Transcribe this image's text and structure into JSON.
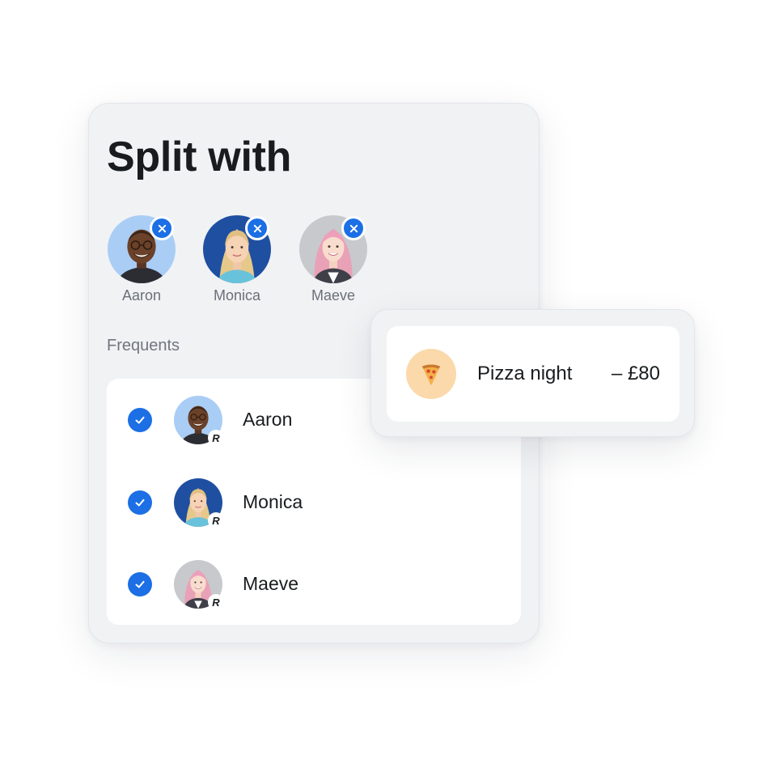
{
  "split_panel": {
    "title": "Split with",
    "selected": [
      {
        "name": "Aaron",
        "remove_icon": "close-icon"
      },
      {
        "name": "Monica",
        "remove_icon": "close-icon"
      },
      {
        "name": "Maeve",
        "remove_icon": "close-icon"
      }
    ],
    "frequents_label": "Frequents",
    "frequents": [
      {
        "name": "Aaron",
        "checked": true,
        "badge": "R"
      },
      {
        "name": "Monica",
        "checked": true,
        "badge": "R"
      },
      {
        "name": "Maeve",
        "checked": true,
        "badge": "R"
      }
    ]
  },
  "transaction": {
    "icon": "pizza-icon",
    "name": "Pizza night",
    "amount": "– £80"
  },
  "colors": {
    "accent": "#1c6fe5",
    "card_bg": "#f0f2f4",
    "text": "#191c1f",
    "muted": "#717680",
    "pizza_bg": "#fbd9ab"
  }
}
